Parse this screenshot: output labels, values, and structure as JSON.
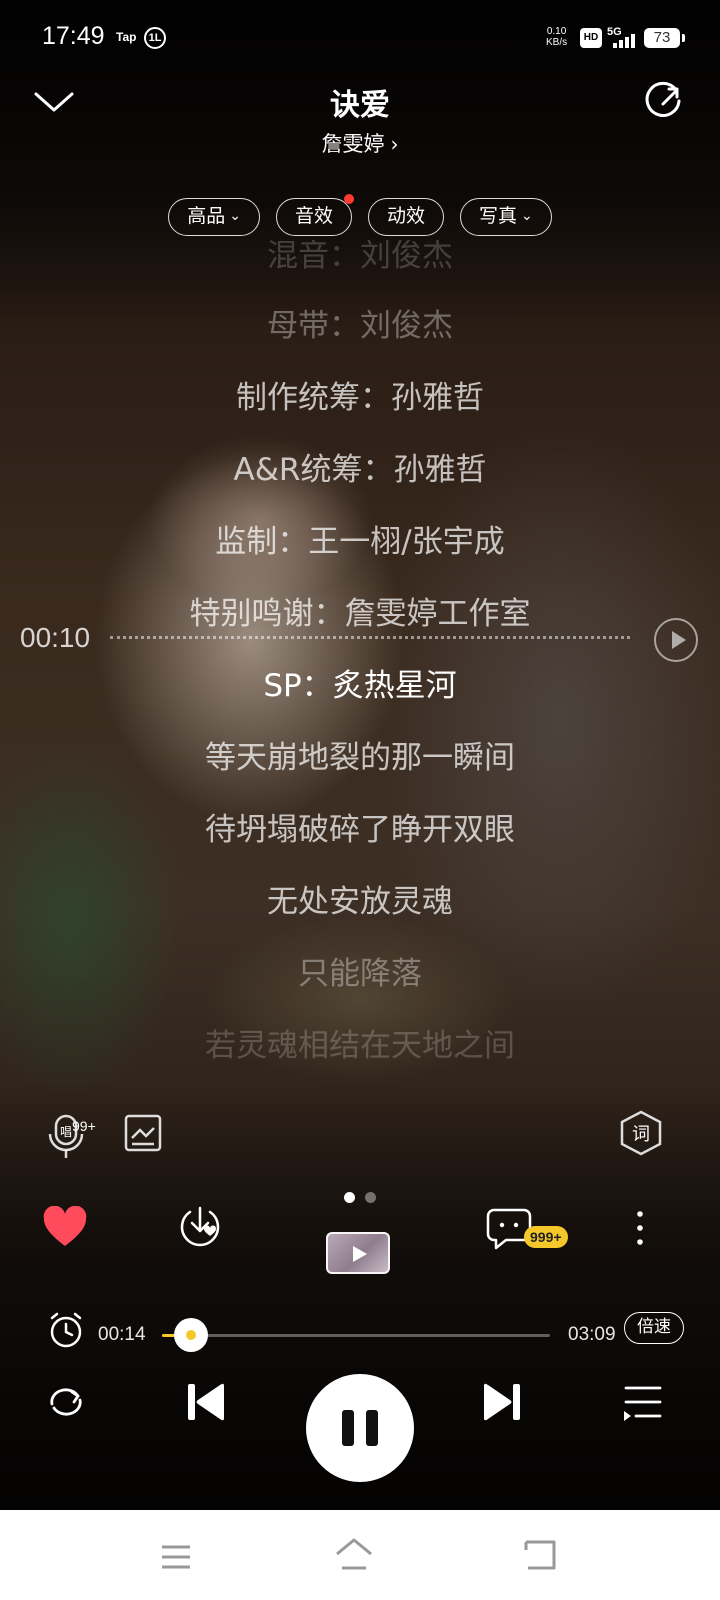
{
  "status_bar": {
    "time": "17:49",
    "tap_label": "Tap",
    "circle_label": "1L",
    "net_speed_value": "0.10",
    "net_speed_unit": "KB/s",
    "hd_label": "HD",
    "network": "5G",
    "battery": "73"
  },
  "header": {
    "song_title": "诀爱",
    "artist": "詹雯婷"
  },
  "options": [
    {
      "label": "高品",
      "has_dropdown": true,
      "dot": false
    },
    {
      "label": "音效",
      "has_dropdown": false,
      "dot": true
    },
    {
      "label": "动效",
      "has_dropdown": false,
      "dot": false
    },
    {
      "label": "写真",
      "has_dropdown": true,
      "dot": false
    }
  ],
  "lyrics": [
    "混音：刘俊杰",
    "母带：刘俊杰",
    "制作统筹：孙雅哲",
    "A&R统筹：孙雅哲",
    "监制：王一栩/张宇成",
    "特别鸣谢：詹雯婷工作室",
    "SP：炙热星河",
    "等天崩地裂的那一瞬间",
    "待坍塌破碎了睁开双眼",
    "无处安放灵魂",
    "只能降落",
    "若灵魂相结在天地之间"
  ],
  "lyric_seek": {
    "time": "00:10"
  },
  "tools": {
    "sing_badge": "99+",
    "lyric_icon_label": "词"
  },
  "pager": {
    "count": 2,
    "active": 0
  },
  "actions": {
    "comment_badge": "999+"
  },
  "progress": {
    "elapsed": "00:14",
    "duration": "03:09",
    "fraction": 0.074,
    "speed_label": "倍速"
  },
  "colors": {
    "accent": "#f5c82a",
    "like": "#ff4b5c",
    "notification_dot": "#ff3b30"
  }
}
